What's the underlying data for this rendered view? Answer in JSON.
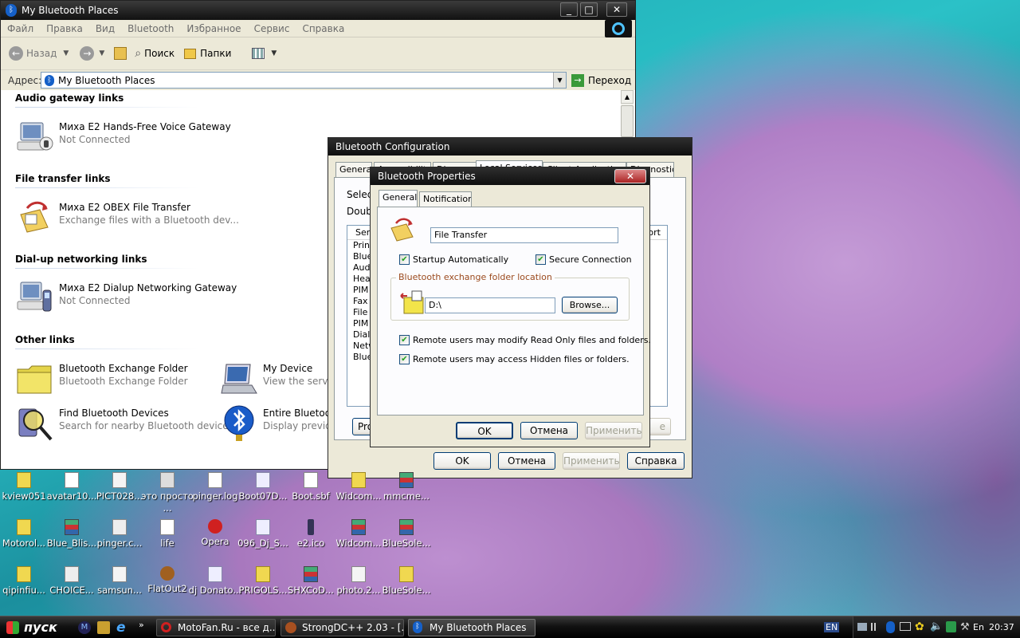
{
  "explorer": {
    "title": "My Bluetooth Places",
    "menu": [
      "Файл",
      "Правка",
      "Вид",
      "Bluetooth",
      "Избранное",
      "Сервис",
      "Справка"
    ],
    "toolbar": {
      "back": "Назад",
      "search": "Поиск",
      "folders": "Папки"
    },
    "address": {
      "label": "Адрес:",
      "value": "My Bluetooth Places",
      "go": "Переход"
    },
    "groups": {
      "audio": "Audio gateway links",
      "file": "File transfer links",
      "dialup": "Dial-up networking links",
      "other": "Other links"
    },
    "items": {
      "voice": {
        "title": "Миха E2 Hands-Free Voice Gateway",
        "subtitle": "Not Connected"
      },
      "obex": {
        "title": "Миха E2 OBEX File Transfer",
        "subtitle": "Exchange files with a Bluetooth dev..."
      },
      "dun": {
        "title": "Миха E2 Dialup Networking Gateway",
        "subtitle": "Not Connected"
      },
      "folder": {
        "title": "Bluetooth Exchange Folder",
        "subtitle": "Bluetooth Exchange Folder"
      },
      "mydevice": {
        "title": "My Device",
        "subtitle": "View the service"
      },
      "find": {
        "title": "Find Bluetooth Devices",
        "subtitle": "Search for nearby Bluetooth devices."
      },
      "entire": {
        "title": "Entire Bluetooth",
        "subtitle": "Display previou"
      }
    }
  },
  "config": {
    "title": "Bluetooth Configuration",
    "tabs": [
      "General",
      "Accessibility",
      "Discovery",
      "Local Services",
      "Client Applications",
      "Diagnostics"
    ],
    "select_text": "Select",
    "double_text": "Double",
    "col_service": "Serv",
    "col_port": "ort",
    "rows": [
      "Print",
      "Blue",
      "Audi",
      "Head",
      "PIM",
      "Fax",
      "File",
      "PIM",
      "Dial-",
      "Netw",
      "Blue"
    ],
    "prop_btn": "Pro",
    "partial_btn": "e",
    "buttons": {
      "ok": "OK",
      "cancel": "Отмена",
      "apply": "Применить",
      "help": "Справка"
    }
  },
  "props": {
    "title": "Bluetooth Properties",
    "tabs": {
      "general": "General",
      "notifications": "Notifications"
    },
    "name_value": "File Transfer",
    "startup": "Startup Automatically",
    "secure": "Secure Connection",
    "folder_group": "Bluetooth exchange folder location",
    "folder_value": "D:\\",
    "browse": "Browse...",
    "modify_ro": "Remote users may modify Read Only files and folders.",
    "access_hidden": "Remote users may access Hidden files or folders.",
    "buttons": {
      "ok": "OK",
      "cancel": "Отмена",
      "apply": "Применить"
    }
  },
  "desktop": {
    "row1": [
      "kview051",
      "avatar10...",
      "PICT028...",
      "это просто ...",
      "pinger.log",
      "Boot07D...",
      "Boot.sbf",
      "Widcom...",
      "mmcme..."
    ],
    "row2": [
      "Motorol...",
      "Blue_Blis...",
      "pinger.c...",
      "life",
      "Opera",
      "096_Dj_S...",
      "e2.ico",
      "Widcom...",
      "BlueSole..."
    ],
    "row3": [
      "qipinfiu...",
      "CHOICE...",
      "samsun...",
      "FlatOut2",
      "dj Donato...",
      "PRIGOLS...",
      "SHXCoD...",
      "photo.2...",
      "BlueSole..."
    ]
  },
  "taskbar": {
    "start": "пуск",
    "tasks": [
      "MotoFan.Ru - все д...",
      "StrongDC++ 2.03 - [...",
      "My Bluetooth Places"
    ],
    "lang": "EN",
    "lang2": "En",
    "clock": "20:37"
  },
  "colors": {
    "accent": "#003c74",
    "group_label": "#9b4a1e"
  }
}
